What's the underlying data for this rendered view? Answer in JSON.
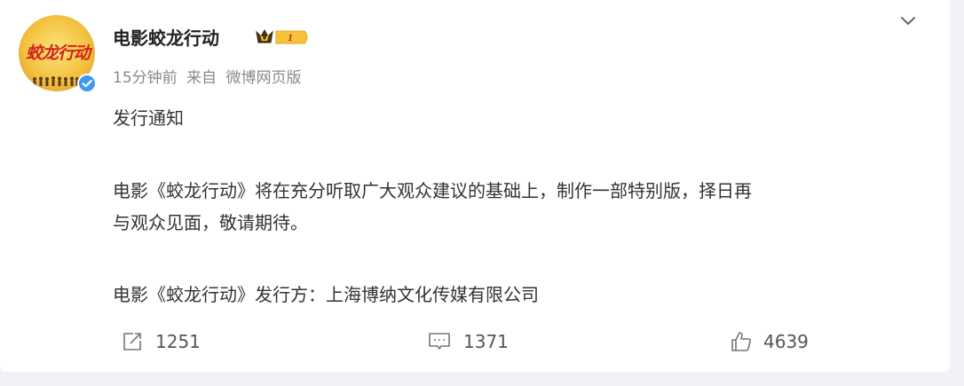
{
  "post": {
    "author": {
      "name": "电影蛟龙行动",
      "avatar_logo_text": "蛟龙行动",
      "badge_level": "1",
      "verified_icon": "verified-check-icon"
    },
    "meta": {
      "time": "15分钟前",
      "source_prefix": "来自",
      "source": "微博网页版"
    },
    "content": {
      "line1": "发行通知",
      "line2": "电影《蛟龙行动》将在充分听取广大观众建议的基础上，制作一部特别版，择日再",
      "line3": "与观众见面，敬请期待。",
      "line4": "电影《蛟龙行动》发行方：上海博纳文化传媒有限公司"
    },
    "actions": {
      "repost_count": "1251",
      "comment_count": "1371",
      "like_count": "4639"
    },
    "icons": {
      "menu": "chevron-down-icon",
      "repost": "repost-icon",
      "comment": "comment-icon",
      "like": "thumbs-up-icon"
    }
  },
  "colors": {
    "page_bg": "#f1f2f5",
    "card_bg": "#ffffff",
    "verified_blue": "#3d99f5",
    "badge_gold": "#f7c23a"
  }
}
